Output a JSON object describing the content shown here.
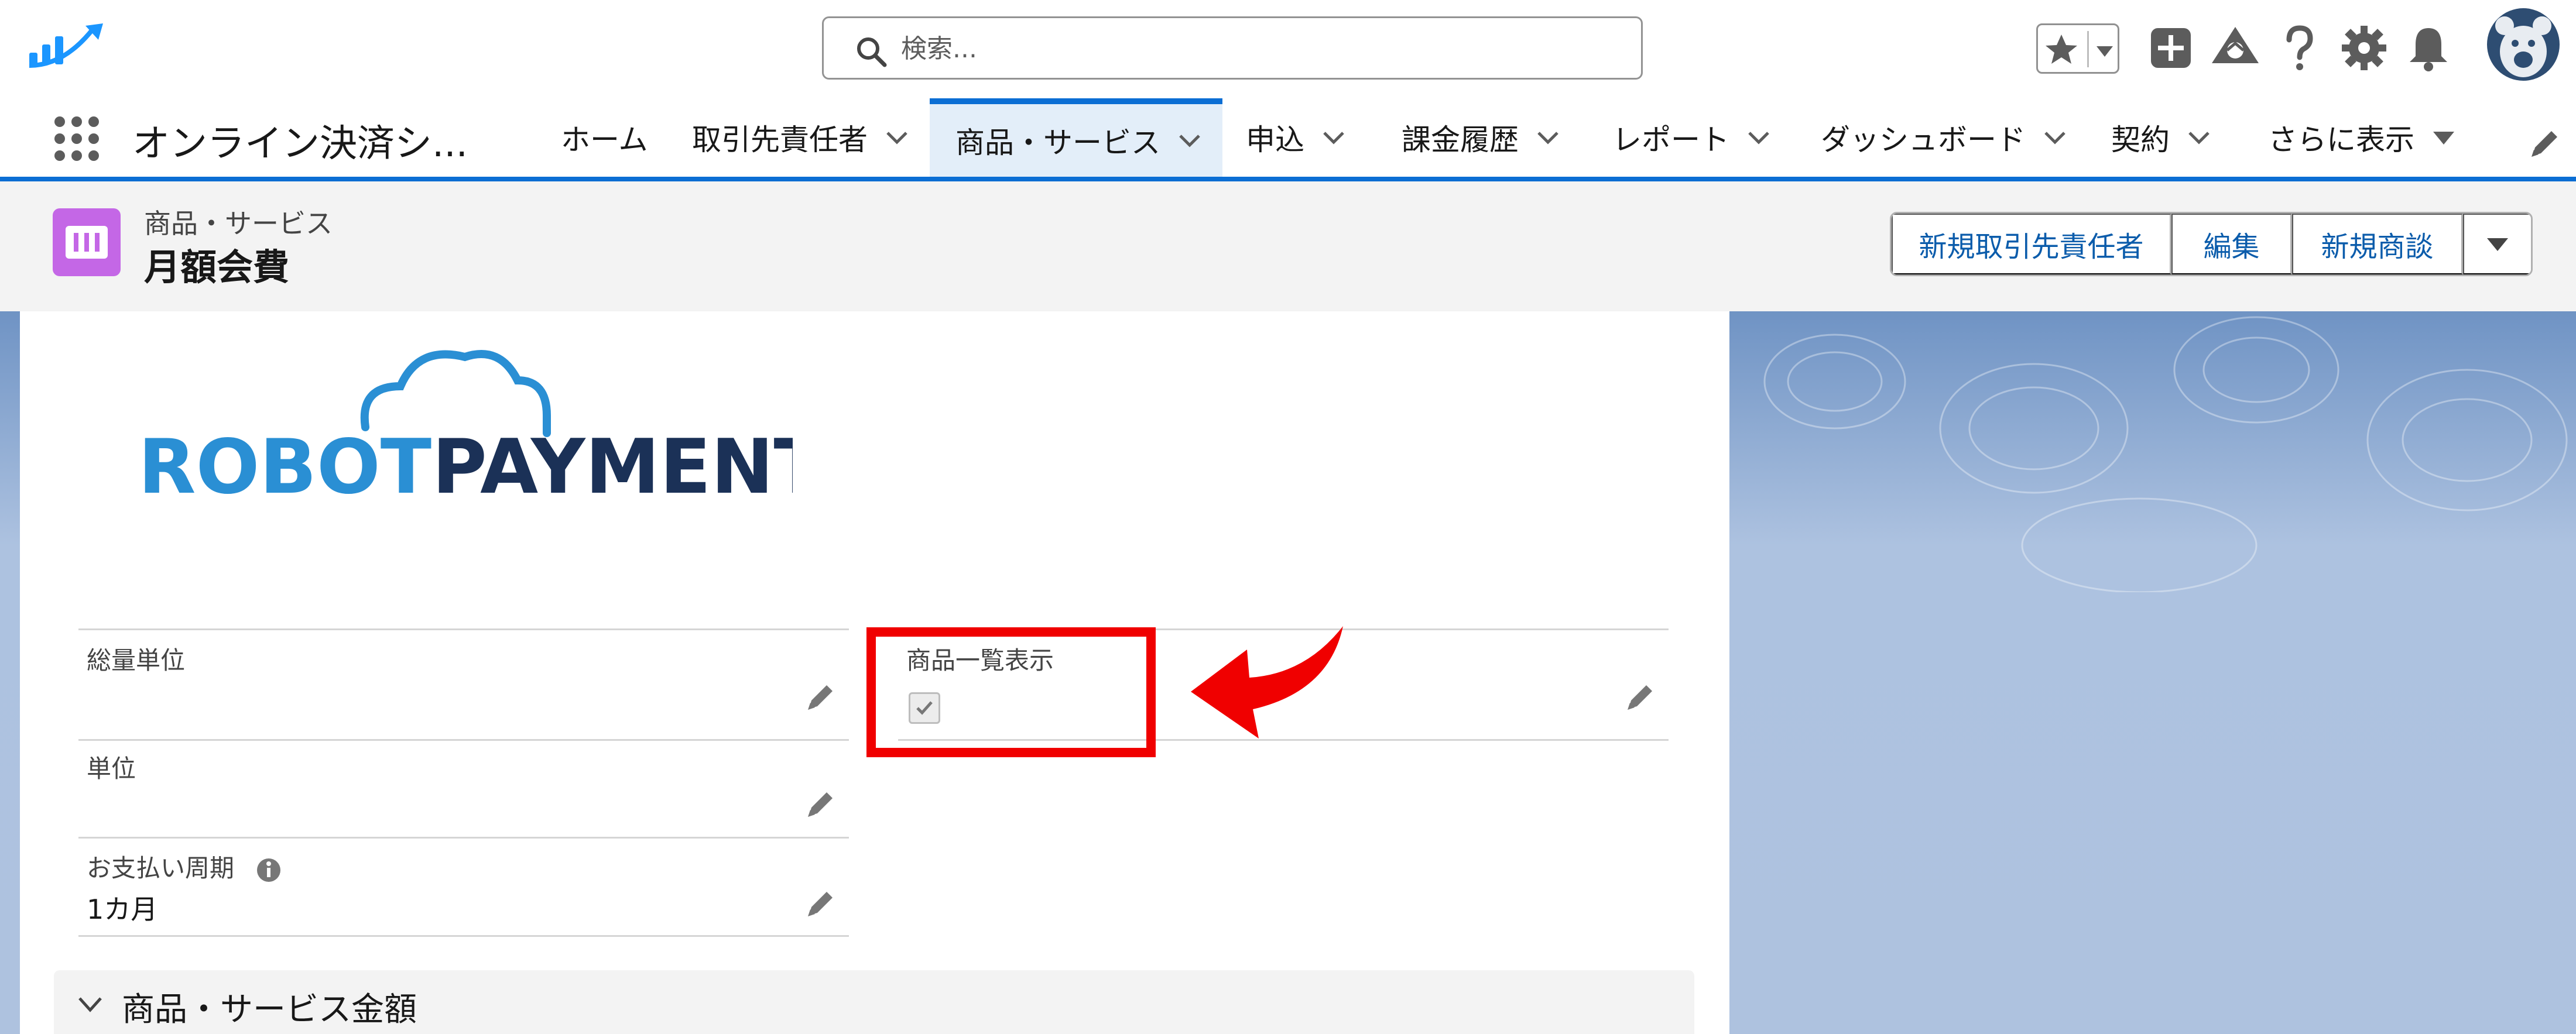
{
  "header": {
    "search_placeholder": "検索..."
  },
  "nav": {
    "app_name": "オンライン決済シ...",
    "tabs": [
      {
        "label": "ホーム"
      },
      {
        "label": "取引先責任者"
      },
      {
        "label": "商品・サービス"
      },
      {
        "label": "申込"
      },
      {
        "label": "課金履歴"
      },
      {
        "label": "レポート"
      },
      {
        "label": "ダッシュボード"
      },
      {
        "label": "契約"
      },
      {
        "label": "さらに表示"
      }
    ]
  },
  "record": {
    "object_type": "商品・サービス",
    "name": "月額会費",
    "actions": [
      "新規取引先責任者",
      "編集",
      "新規商談"
    ]
  },
  "logo": {
    "word1": "ROBOT",
    "word2": "PAYMENT",
    "color_blue": "#2a8fd4",
    "color_navy": "#1b3157"
  },
  "fields": {
    "total_unit": {
      "label": "総量単位",
      "value": ""
    },
    "product_list_display": {
      "label": "商品一覧表示",
      "checked": true
    },
    "unit": {
      "label": "単位",
      "value": ""
    },
    "payment_cycle": {
      "label": "お支払い周期",
      "value": "1カ月"
    }
  },
  "section": {
    "title": "商品・サービス金額"
  },
  "colors": {
    "brand_blue": "#0b6ed4",
    "link_blue": "#0b5cab",
    "object_icon": "#c467e6",
    "annotation_red": "#f00000"
  }
}
